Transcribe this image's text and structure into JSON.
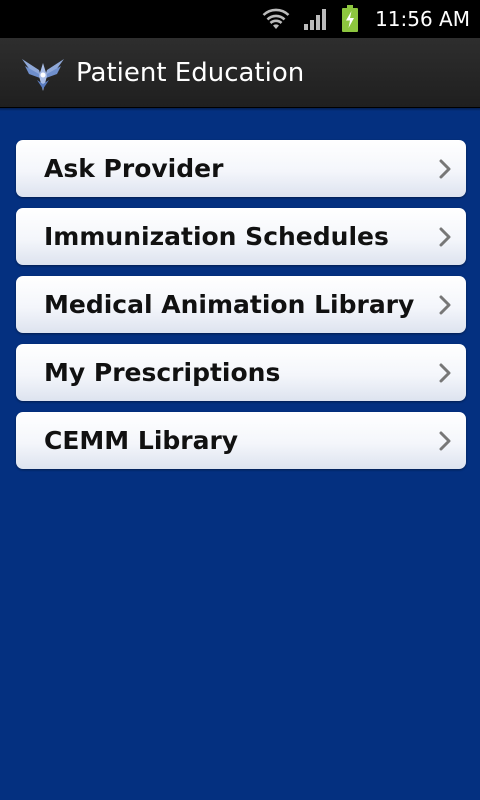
{
  "status_bar": {
    "time": "11:56 AM",
    "icons": [
      "wifi-icon",
      "signal-icon",
      "battery-charging-icon"
    ],
    "colors": {
      "battery": "#8dc63f"
    }
  },
  "app_bar": {
    "title": "Patient Education",
    "logo": "air-force-wings-logo"
  },
  "menu": {
    "items": [
      {
        "label": "Ask Provider",
        "icon": "chevron-right-icon"
      },
      {
        "label": "Immunization Schedules",
        "icon": "chevron-right-icon"
      },
      {
        "label": "Medical Animation Library",
        "icon": "chevron-right-icon"
      },
      {
        "label": "My Prescriptions",
        "icon": "chevron-right-icon"
      },
      {
        "label": "CEMM Library",
        "icon": "chevron-right-icon"
      }
    ]
  },
  "colors": {
    "background": "#043080",
    "title_bar": "#262626",
    "item_background": "#f4f6fb",
    "item_text": "#111111"
  }
}
